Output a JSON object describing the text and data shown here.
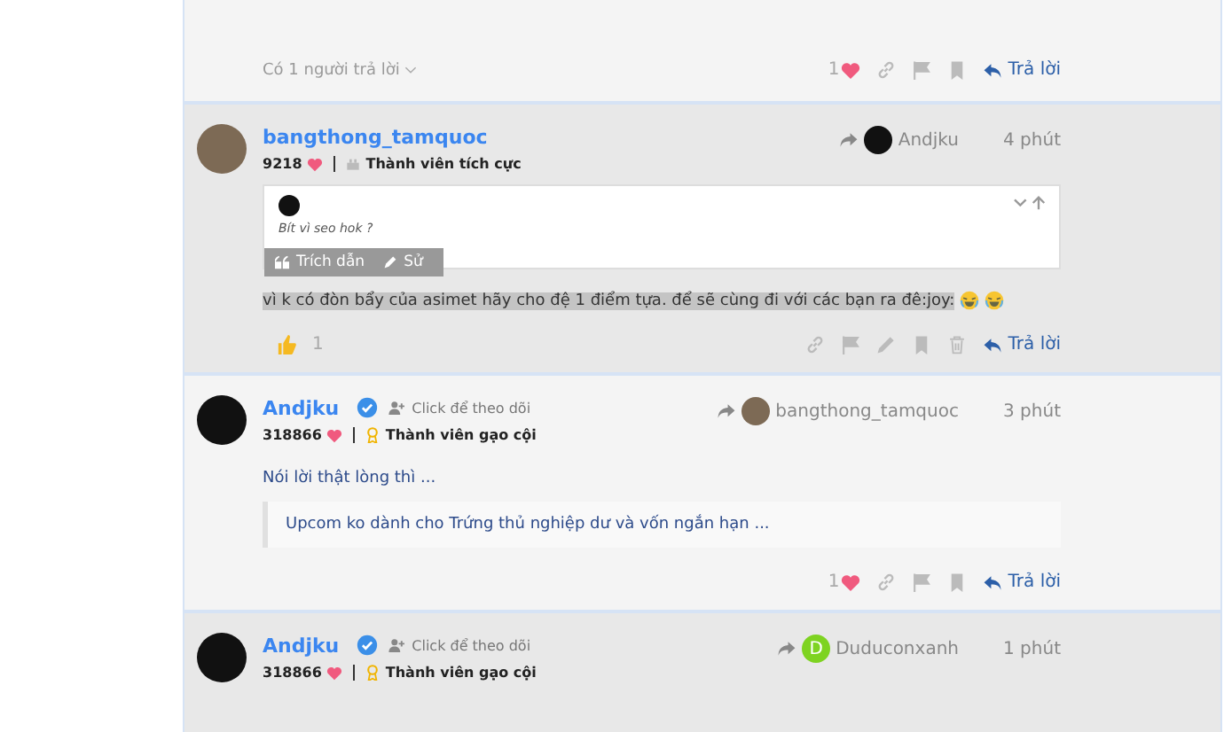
{
  "posts": [
    {
      "kind": "footer_only",
      "highlighted": false,
      "footer": {
        "replies_label": "Có 1 người trả lời",
        "like": {
          "kind": "heart",
          "count": "1"
        },
        "actions": [
          {
            "kind": "link"
          },
          {
            "kind": "flag"
          },
          {
            "kind": "bookmark"
          }
        ],
        "reply_label": "Trả lời"
      }
    },
    {
      "kind": "full",
      "highlighted": true,
      "avatar": {
        "kind": "photo"
      },
      "author": "bangthong_tamquoc",
      "verified": false,
      "score": "9218",
      "rank": {
        "kind": "hands",
        "text": "Thành viên tích cực"
      },
      "reply_to": {
        "name": "Andjku",
        "avatar": {
          "kind": "dark"
        }
      },
      "time": "4 phút",
      "quote": {
        "text": "Bít vì seo hok ?",
        "toolbar": [
          {
            "kind": "quote",
            "label": "Trích dẫn"
          },
          {
            "kind": "edit",
            "label": "Sử"
          }
        ]
      },
      "body": "vì k có đòn bẩy của asimet hãy cho đệ 1 điểm tựa. để sẽ cùng đi với các bạn ra đê:joy:",
      "body_selected": true,
      "emojis": [
        {
          "kind": "laughing"
        },
        {
          "kind": "laughing"
        }
      ],
      "footer": {
        "like": {
          "kind": "thumb",
          "count": "1"
        },
        "actions": [
          {
            "kind": "link"
          },
          {
            "kind": "flag"
          },
          {
            "kind": "edit"
          },
          {
            "kind": "bookmark"
          },
          {
            "kind": "delete"
          }
        ],
        "reply_label": "Trả lời"
      }
    },
    {
      "kind": "full",
      "highlighted": false,
      "avatar": {
        "kind": "dark"
      },
      "author": "Andjku",
      "verified": true,
      "follow_label": "Click để theo dõi",
      "score": "318866",
      "rank": {
        "kind": "medal",
        "text": "Thành viên gạo cội"
      },
      "reply_to": {
        "name": "bangthong_tamquoc",
        "avatar": {
          "kind": "photo"
        }
      },
      "time": "3 phút",
      "body": "Nói lời thật lòng thì ...",
      "body_selected": false,
      "blockquote": "Upcom ko dành cho Trứng thủ nghiệp dư và vốn ngắn hạn ...",
      "footer": {
        "like": {
          "kind": "heart",
          "count": "1"
        },
        "actions": [
          {
            "kind": "link"
          },
          {
            "kind": "flag"
          },
          {
            "kind": "bookmark"
          }
        ],
        "reply_label": "Trả lời"
      }
    },
    {
      "kind": "full",
      "highlighted": true,
      "avatar": {
        "kind": "dark"
      },
      "author": "Andjku",
      "verified": true,
      "follow_label": "Click để theo dõi",
      "score": "318866",
      "rank": {
        "kind": "medal",
        "text": "Thành viên gạo cội"
      },
      "reply_to": {
        "name": "Duduconxanh",
        "avatar": {
          "kind": "letter",
          "letter": "D",
          "color": "#7ed321"
        }
      },
      "time": "1 phút"
    }
  ]
}
